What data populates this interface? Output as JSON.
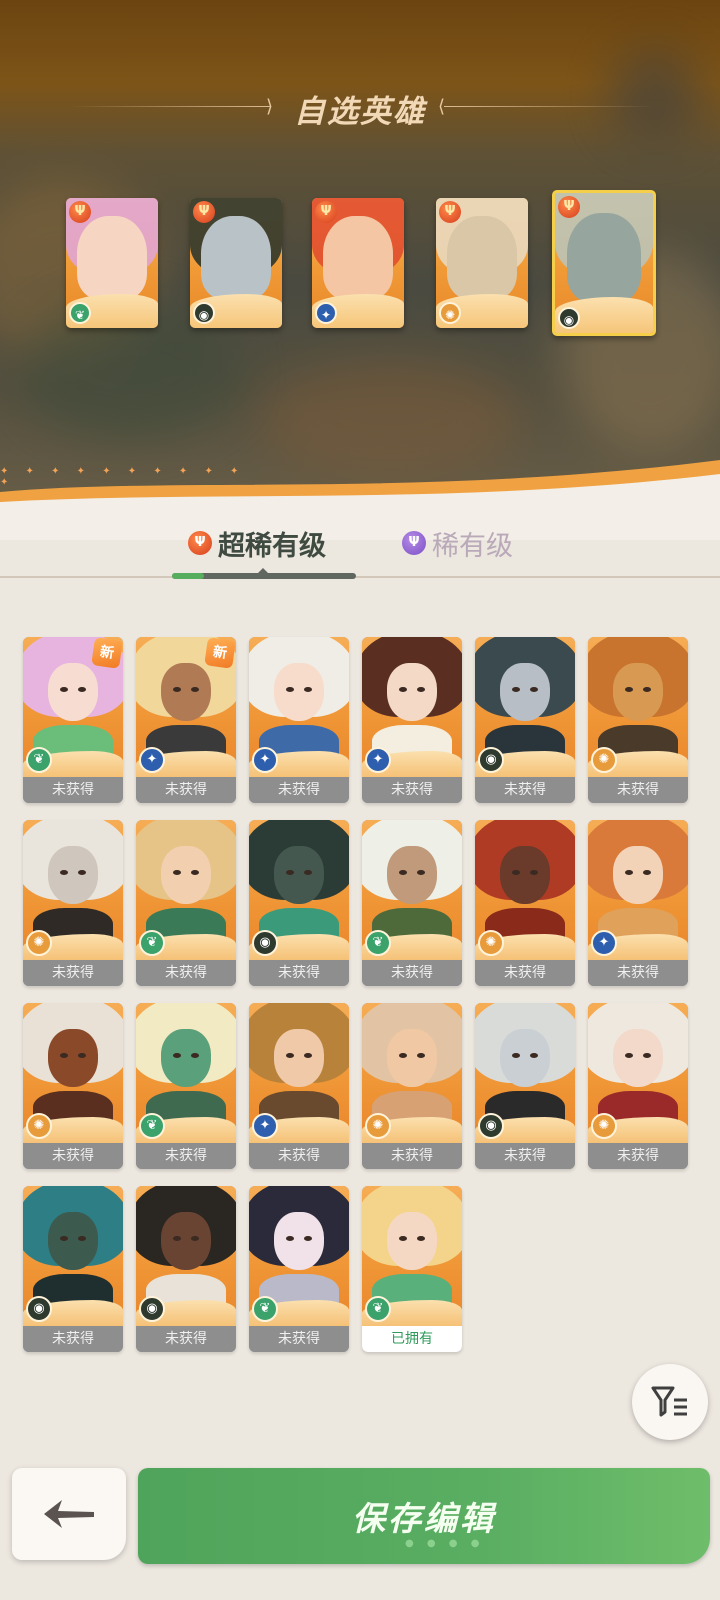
{
  "header": {
    "title": "自选英雄"
  },
  "selected_heroes": [
    {
      "name_icon": "hero-portrait-pink-hair-icon",
      "faction": "forest-icon",
      "hair": "#e0a6dc",
      "skin": "#f6d6c2",
      "accent": "#9a6a2e"
    },
    {
      "name_icon": "hero-portrait-dark-hair-icon",
      "faction": "dark-icon",
      "hair": "#22302a",
      "skin": "#b9c2c6",
      "accent": "#3a3a3a"
    },
    {
      "name_icon": "hero-portrait-red-hair-icon",
      "faction": "light-icon",
      "hair": "#e04a2e",
      "skin": "#f4c6a3",
      "accent": "#b03020"
    },
    {
      "name_icon": "hero-portrait-beast-icon",
      "faction": "sun-icon",
      "hair": "#e8dcc6",
      "skin": "#d9c7a8",
      "accent": "#7a5a3a"
    },
    {
      "name_icon": "hero-portrait-crowned-warrior-icon",
      "faction": "dark-icon",
      "hair": "#b9c5bd",
      "skin": "#96a69e",
      "accent": "#d6b04a",
      "active": true
    }
  ],
  "tabs": [
    {
      "label": "超稀有级",
      "icon": "trident-rank-icon",
      "active": true
    },
    {
      "label": "稀有级",
      "icon": "purple-rank-icon",
      "active": false
    }
  ],
  "heroes": [
    {
      "status": "未获得",
      "new": "新",
      "faction": "forest",
      "hair": "#e7b4df",
      "skin": "#f7dcd2",
      "body": "#6bbd7a"
    },
    {
      "status": "未获得",
      "new": "新",
      "faction": "light",
      "hair": "#f2d79a",
      "skin": "#b07a55",
      "body": "#3a3a3a"
    },
    {
      "status": "未获得",
      "faction": "light",
      "hair": "#f0ede6",
      "skin": "#f7dccb",
      "body": "#3f6aa8"
    },
    {
      "status": "未获得",
      "faction": "light",
      "hair": "#5a2f22",
      "skin": "#f3d9c6",
      "body": "#f3eee0"
    },
    {
      "status": "未获得",
      "faction": "dark",
      "hair": "#3a4a4e",
      "skin": "#b7bec6",
      "body": "#29353a"
    },
    {
      "status": "未获得",
      "faction": "sun",
      "hair": "#c9742e",
      "skin": "#d89a52",
      "body": "#4a3a2a"
    },
    {
      "status": "未获得",
      "faction": "sun",
      "hair": "#e9e4dc",
      "skin": "#cfc7bd",
      "body": "#2f2a25"
    },
    {
      "status": "未获得",
      "faction": "forest",
      "hair": "#e6c386",
      "skin": "#f2cfae",
      "body": "#3a7a56"
    },
    {
      "status": "未获得",
      "faction": "dark",
      "hair": "#2b3c36",
      "skin": "#45584f",
      "body": "#3a9a7a"
    },
    {
      "status": "未获得",
      "faction": "forest",
      "hair": "#eef0e8",
      "skin": "#c09a7a",
      "body": "#4f6a3a"
    },
    {
      "status": "未获得",
      "faction": "sun",
      "hair": "#b03b25",
      "skin": "#6a3a2a",
      "body": "#8a2a1a"
    },
    {
      "status": "未获得",
      "faction": "light",
      "hair": "#d97a3a",
      "skin": "#f2d3b8",
      "body": "#e0a15a"
    },
    {
      "status": "未获得",
      "faction": "sun",
      "hair": "#e9e1d6",
      "skin": "#8a4a2a",
      "body": "#5a2f1f"
    },
    {
      "status": "未获得",
      "faction": "forest",
      "hair": "#f2eac2",
      "skin": "#5aa07a",
      "body": "#3f6a4f"
    },
    {
      "status": "未获得",
      "faction": "light",
      "hair": "#b8823a",
      "skin": "#f0c9a8",
      "body": "#6a4a2e"
    },
    {
      "status": "未获得",
      "faction": "sun",
      "hair": "#e2c4a4",
      "skin": "#f0c9a4",
      "body": "#d7a173"
    },
    {
      "status": "未获得",
      "faction": "dark",
      "hair": "#d9dbd9",
      "skin": "#c9cfd3",
      "body": "#2a2a2a"
    },
    {
      "status": "未获得",
      "faction": "sun",
      "hair": "#efe8df",
      "skin": "#f3d9ca",
      "body": "#9a2a2a"
    },
    {
      "status": "未获得",
      "faction": "dark",
      "hair": "#2e7e86",
      "skin": "#3c5a4e",
      "body": "#1f2e2e"
    },
    {
      "status": "未获得",
      "faction": "dark",
      "hair": "#2a2622",
      "skin": "#6a4432",
      "body": "#e8e2d8"
    },
    {
      "status": "未获得",
      "faction": "forest",
      "hair": "#2b2a3a",
      "skin": "#f0e2e8",
      "body": "#b9b9c9"
    },
    {
      "status": "已拥有",
      "faction": "forest",
      "hair": "#f3d48a",
      "skin": "#f5d8c4",
      "body": "#59b07a",
      "owned": true
    }
  ],
  "buttons": {
    "back_icon": "back-arrow-icon",
    "filter_icon": "filter-icon",
    "save_label": "保存编辑"
  },
  "colors": {
    "card_orange": "#f09a36",
    "unobtained_gray": "#8e8e8e",
    "save_green": "#57ab5f",
    "selected_border": "#f6cf4a"
  }
}
